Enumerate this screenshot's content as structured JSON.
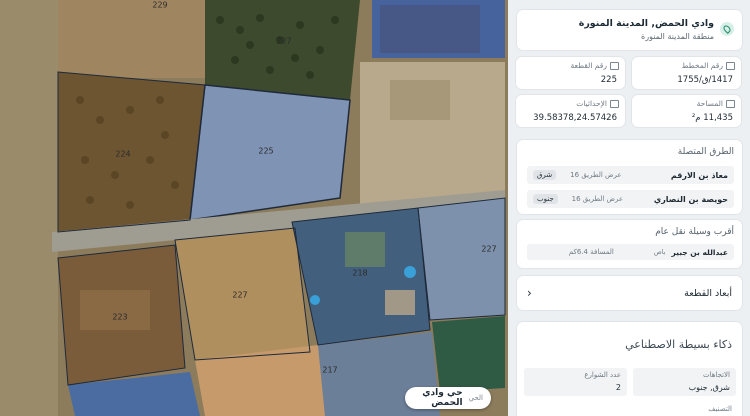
{
  "map": {
    "plots": [
      {
        "id": "plot-229",
        "label": "229"
      },
      {
        "id": "plot-227a",
        "label": "227"
      },
      {
        "id": "plot-224",
        "label": "224"
      },
      {
        "id": "plot-225",
        "label": "225"
      },
      {
        "id": "plot-227b",
        "label": "227"
      },
      {
        "id": "plot-223",
        "label": "223"
      },
      {
        "id": "plot-218",
        "label": "218"
      },
      {
        "id": "plot-227c",
        "label": "227"
      },
      {
        "id": "plot-217",
        "label": "217"
      }
    ],
    "badge": {
      "main": "حي وادي الحمض",
      "sub": "الحي"
    }
  },
  "panel": {
    "title": "وادي الحمض, المدينة المنورة",
    "subtitle": "منطقة المدينة المنورة",
    "plot_number": {
      "label": "رقم القطعة",
      "value": "225"
    },
    "scheme_number": {
      "label": "رقم المخطط",
      "value": "1417/ق/1755"
    },
    "coordinates": {
      "label": "الإحداثيات",
      "value": "39.58378,24.57426"
    },
    "area": {
      "label": "المساحة",
      "value": "11,435 م²"
    },
    "roads": {
      "title": "الطرق المتصلة",
      "items": [
        {
          "name": "معاذ بن الارقم",
          "width": "عرض الطريق 16",
          "dir": "شرق"
        },
        {
          "name": "حويصة بن النصاري",
          "width": "عرض الطريق 16",
          "dir": "جنوب"
        }
      ]
    },
    "transit": {
      "title": "أقرب وسيلة نقل عام",
      "name": "عبدالله بن جبير",
      "type": "باص",
      "distance": "المسافة 6.4كم"
    },
    "dims": {
      "title": "أبعاد القطعة"
    },
    "ai": {
      "title": "ذكاء بسيطة الاصطناعي",
      "directions": {
        "label": "الاتجاهات",
        "value": "شرق, جنوب"
      },
      "streets": {
        "label": "عدد الشوارع",
        "value": "2"
      },
      "next_label": "التصنيف"
    }
  }
}
